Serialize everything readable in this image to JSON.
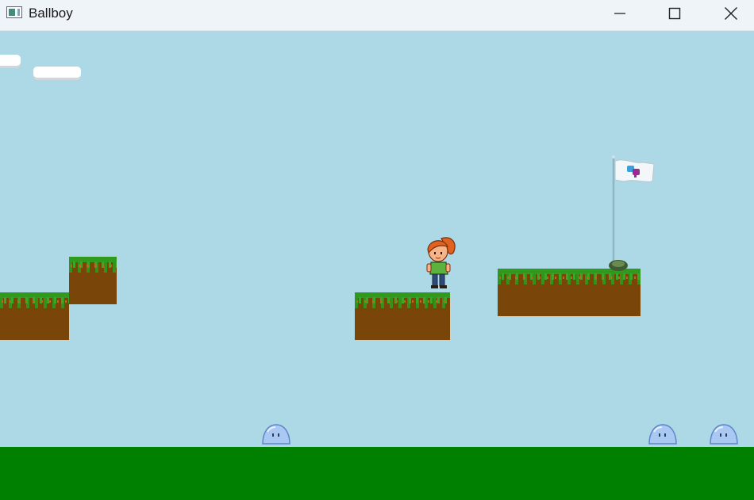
{
  "window": {
    "title": "Ballboy",
    "icon": "app-window-icon",
    "controls": [
      "minimize-icon",
      "maximize-icon",
      "close-icon"
    ]
  },
  "scene": {
    "sky_color": "#add8e6",
    "ground_color": "#008000",
    "platform_dirt_color": "#7a4508",
    "platform_grass_color": "#2f9a1e",
    "sprites": {
      "player": "girl-player-icon",
      "enemies": [
        "slime-enemy-icon",
        "slime-enemy-icon",
        "slime-enemy-icon"
      ],
      "goal": "finish-flag-icon"
    }
  }
}
